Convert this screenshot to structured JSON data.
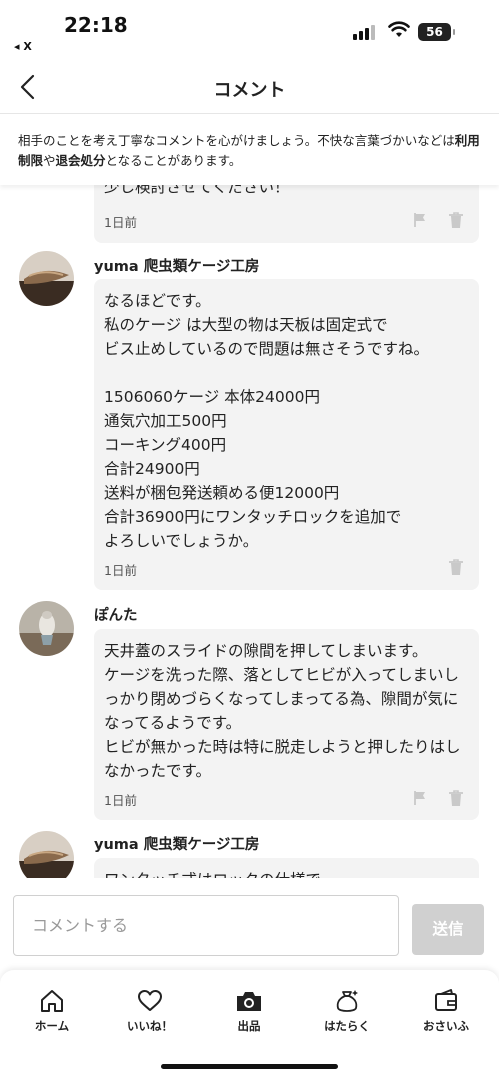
{
  "status_bar": {
    "time": "22:18",
    "back_app": "◂ X",
    "battery": "56"
  },
  "header": {
    "title": "コメント"
  },
  "notice": {
    "part1": "相手のことを考え丁寧なコメントを心がけましょう。不快な言葉づかいなどは",
    "bold1": "利用制限",
    "part2": "や",
    "bold2": "退会処分",
    "part3": "となることがあります。"
  },
  "comments": [
    {
      "author": "",
      "text": "少し検討させてください！",
      "time": "1日前",
      "has_flag": true
    },
    {
      "author": "yuma 爬虫類ケージ工房",
      "text": "なるほどです。\n私のケージ は大型の物は天板は固定式で\nビス止めしているので問題は無さそうですね。\n\n1506060ケージ 本体24000円\n通気穴加工500円\nコーキング400円\n合計24900円\n送料が梱包発送頼める便12000円\n合計36900円にワンタッチロックを追加で\nよろしいでしょうか。",
      "time": "1日前",
      "has_flag": false
    },
    {
      "author": "ぽんた",
      "text": "天井蓋のスライドの隙間を押してしまいます。\nケージを洗った際、落としてヒビが入ってしまいしっかり閉めづらくなってしまってる為、隙間が気になってるようです。\nヒビが無かった時は特に脱走しようと押したりはしなかったです。",
      "time": "1日前",
      "has_flag": true
    },
    {
      "author": "yuma 爬虫類ケージ工房",
      "text": "ワンタッチ式はロックの仕様で",
      "time": "",
      "has_flag": false
    }
  ],
  "comment_input": {
    "placeholder": "コメントする",
    "send_label": "送信"
  },
  "bottom_nav": [
    {
      "label": "ホーム",
      "icon": "home-icon"
    },
    {
      "label": "いいね！",
      "icon": "heart-icon"
    },
    {
      "label": "出品",
      "icon": "camera-icon"
    },
    {
      "label": "はたらく",
      "icon": "money-bag-icon"
    },
    {
      "label": "おさいふ",
      "icon": "wallet-icon"
    }
  ],
  "colors": {
    "bubble_bg": "#f3f3f3",
    "send_disabled": "#d0d0d0",
    "icon_gray": "#c9c9c9"
  }
}
